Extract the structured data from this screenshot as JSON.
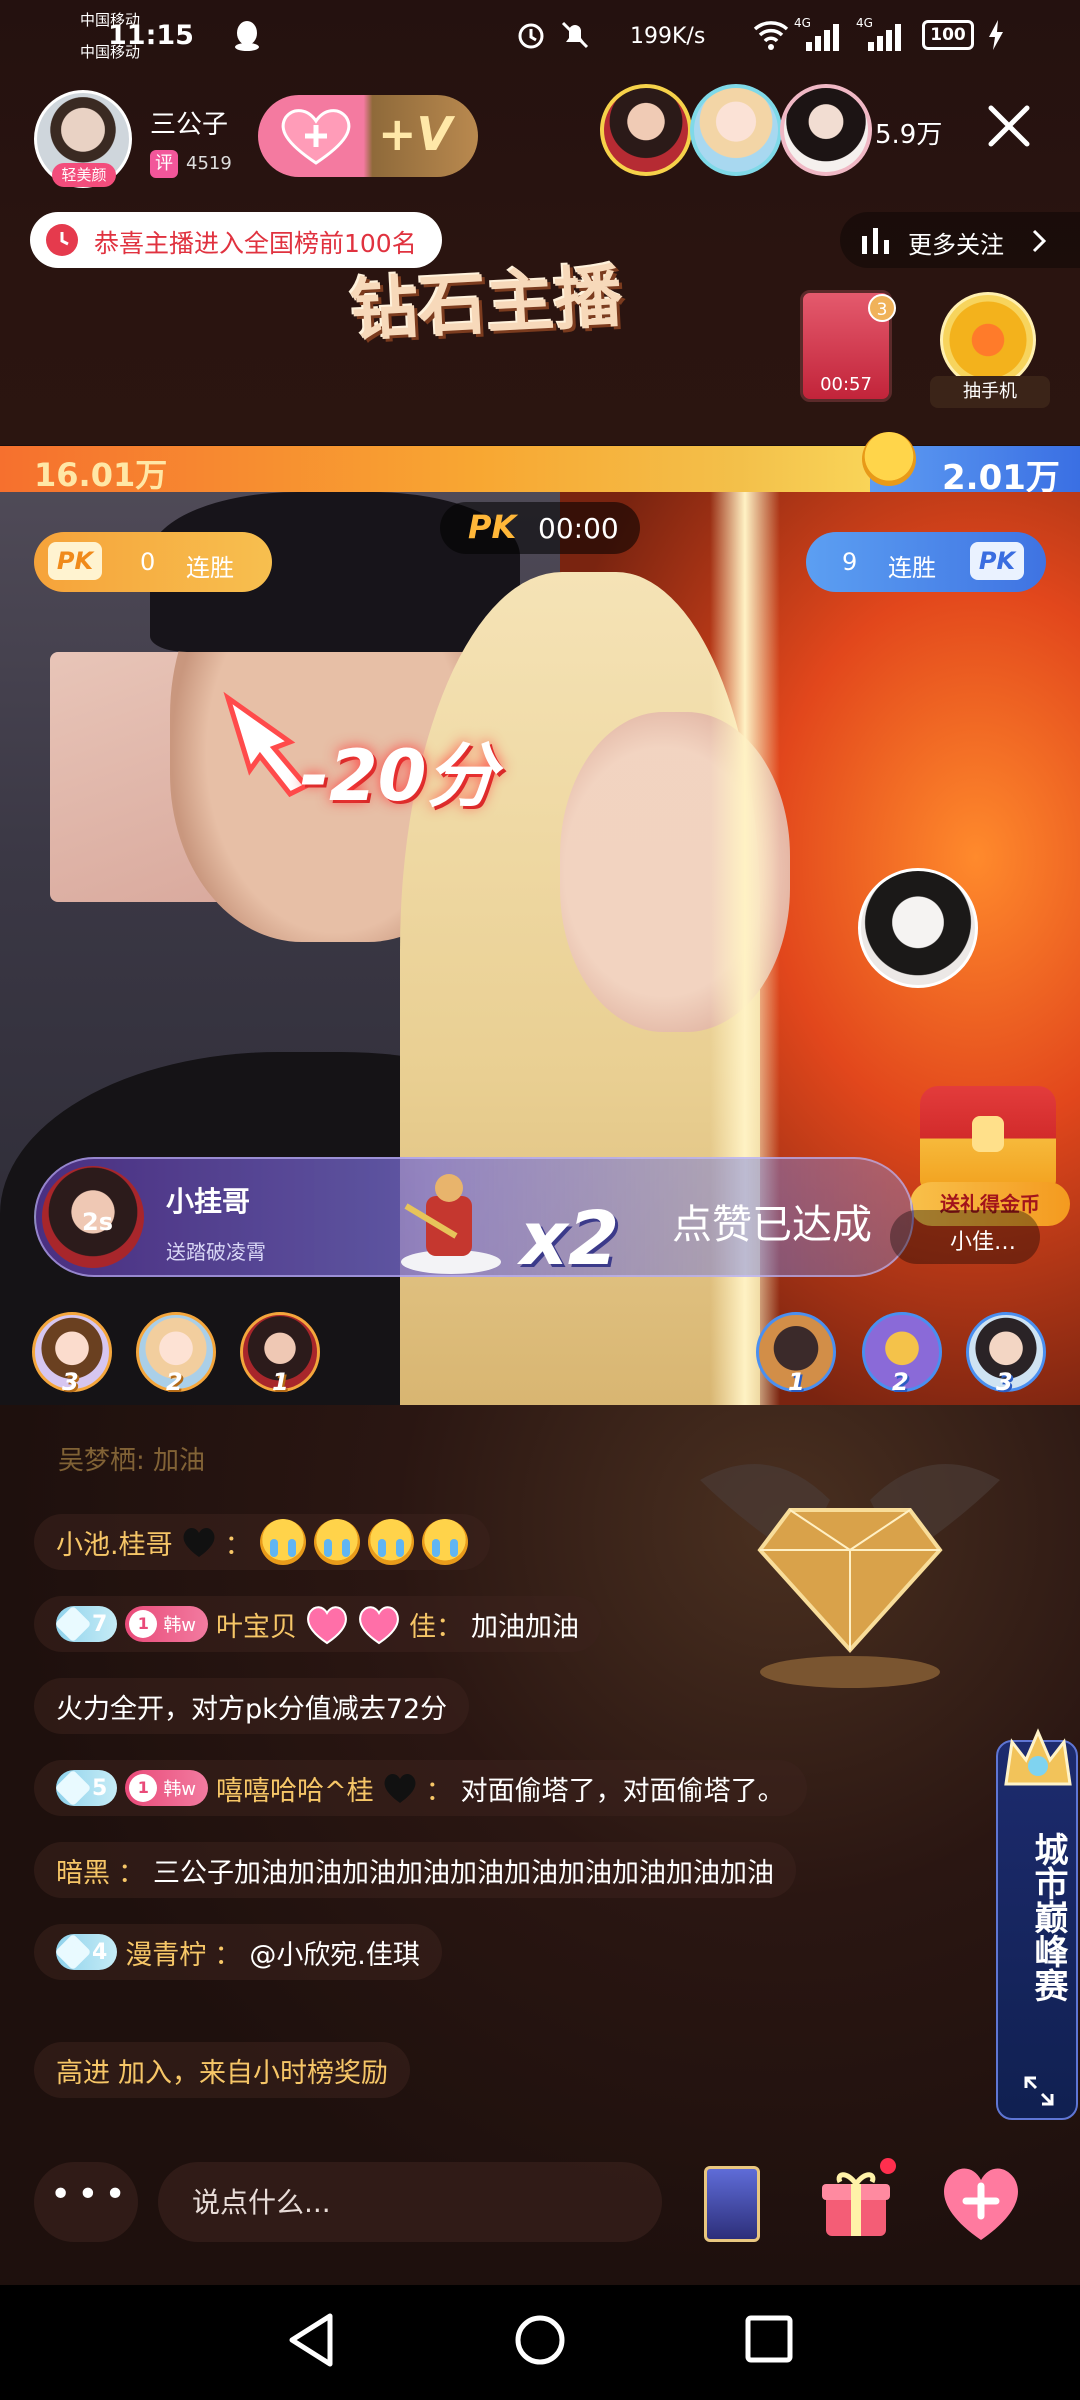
{
  "status_bar": {
    "carrier_1": "中国移动",
    "carrier_2": "中国移动",
    "time": "11:15",
    "net_speed": "199K/s",
    "signal_1": "4G",
    "signal_2": "4G",
    "battery": "100"
  },
  "header": {
    "host_name": "三公子",
    "host_tag": "轻美颜",
    "rating_badge": "评",
    "rating_value": "4519",
    "follow_label": "+V",
    "viewer_count": "5.9万",
    "rank_notice": "恭喜主播进入全国榜前100名",
    "more_follow": "更多关注",
    "diamond_title": "钻石主播",
    "mini_card_badge": "3",
    "mini_card_time": "00:57",
    "phone_lottery": "抽手机"
  },
  "pk": {
    "score_left": "16.01万",
    "score_right": "2.01万",
    "logo": "PK",
    "timer": "00:00",
    "left_logo": "PK",
    "left_streak": "0",
    "left_label": "连胜",
    "right_logo": "PK",
    "right_streak": "9",
    "right_label": "连胜",
    "penalty": "-20分",
    "treasure_label": "送礼得金币"
  },
  "gift_banner": {
    "seconds": "2s",
    "user": "小挂哥",
    "gift_name": "送踏破凌霄",
    "count": "x2",
    "like_done": "点赞已达成",
    "mini_user": "小佳…"
  },
  "ranks": {
    "left": [
      "3",
      "2",
      "1"
    ],
    "right": [
      "1",
      "2",
      "3"
    ]
  },
  "chat": {
    "faded": "吴梦栖: 加油",
    "rows": [
      {
        "user": "小池.桂哥",
        "sep": "：",
        "msg": ""
      },
      {
        "level": "7",
        "fans_level": "1",
        "fans_name": "韩w",
        "user": "叶宝贝",
        "user_tail": "佳：",
        "msg": "加油加油"
      },
      {
        "msg": "火力全开，对方pk分值减去72分"
      },
      {
        "level": "5",
        "fans_level": "1",
        "fans_name": "韩w",
        "user": "嘻嘻哈哈^桂",
        "sep": "：",
        "msg": "对面偷塔了，对面偷塔了。"
      },
      {
        "user": "暗黑",
        "sep": "：",
        "msg": "三公子加油加油加油加油加油加油加油加油加油加油"
      },
      {
        "level": "4",
        "user": "漫青柠",
        "sep": "：",
        "msg": "@小欣宛.佳琪"
      },
      {
        "user": "高进",
        "msg": " 加入，来自小时榜奖励"
      }
    ]
  },
  "city_tab": {
    "title": "城市巅峰赛"
  },
  "input": {
    "placeholder": "说点什么...",
    "more": "•••"
  },
  "colors": {
    "username": "#f6c667",
    "pk_left": "#f8a732",
    "pk_right": "#3a6fe3",
    "accent_pink": "#f34d7c"
  }
}
